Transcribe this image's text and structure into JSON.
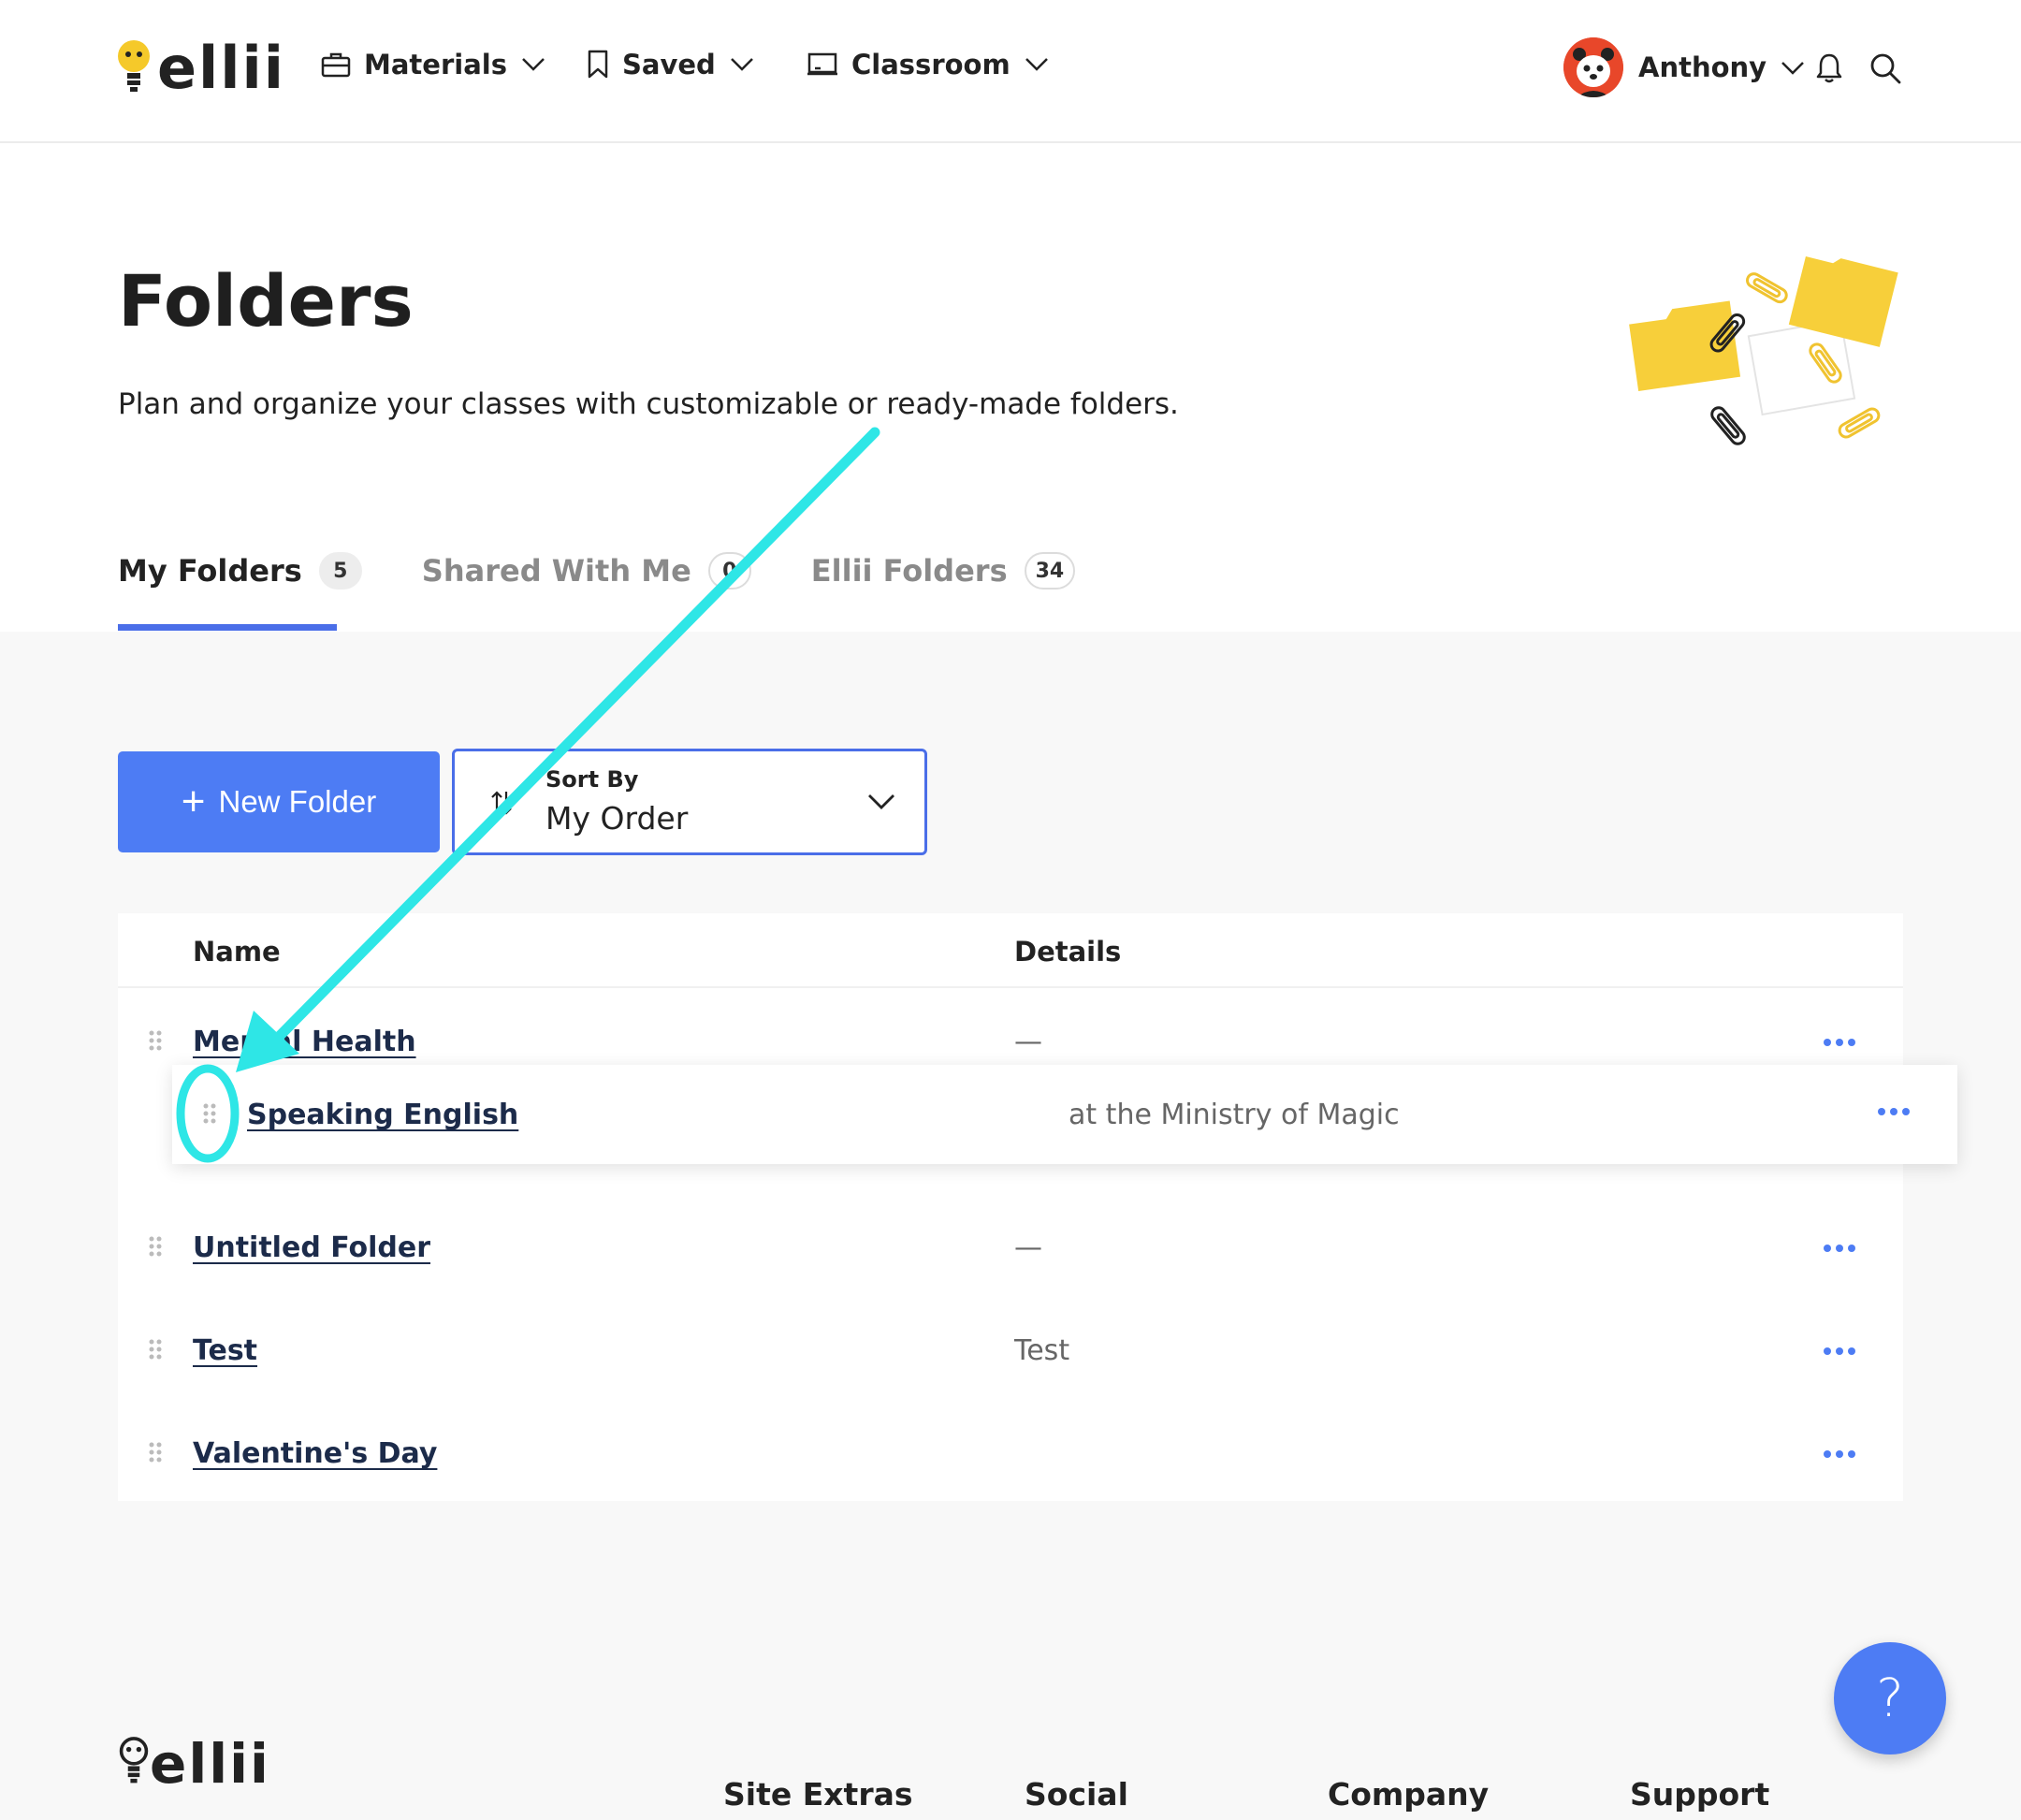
{
  "header": {
    "logo_text": "ellii",
    "nav": [
      {
        "label": "Materials",
        "icon": "briefcase-icon"
      },
      {
        "label": "Saved",
        "icon": "bookmark-icon"
      },
      {
        "label": "Classroom",
        "icon": "classroom-board-icon"
      }
    ],
    "user_name": "Anthony"
  },
  "page": {
    "title": "Folders",
    "subtitle": "Plan and organize your classes with customizable or ready-made folders."
  },
  "tabs": [
    {
      "label": "My Folders",
      "count": "5",
      "active": true
    },
    {
      "label": "Shared With Me",
      "count": "0",
      "active": false
    },
    {
      "label": "Ellii Folders",
      "count": "34",
      "active": false
    }
  ],
  "toolbar": {
    "new_folder_label": "New Folder",
    "sort_caption": "Sort By",
    "sort_value": "My Order"
  },
  "table": {
    "columns": [
      "Name",
      "Details"
    ],
    "rows": [
      {
        "name": "Mental Health",
        "details": "—"
      },
      {
        "name": "Untitled Folder",
        "details": "—"
      },
      {
        "name": "Test",
        "details": "Test"
      },
      {
        "name": "Valentine's Day",
        "details": ""
      }
    ],
    "dragging_row": {
      "name": "Speaking English",
      "details": "at the Ministry of Magic"
    }
  },
  "help_label": "?",
  "footer": {
    "logo_text": "ellii",
    "columns": [
      "Site Extras",
      "Social",
      "Company",
      "Support"
    ]
  },
  "colors": {
    "accent": "#4d7cf4",
    "annotation": "#2ee6e6",
    "avatar": "#e8472a",
    "logo_bulb": "#f5c92a"
  }
}
